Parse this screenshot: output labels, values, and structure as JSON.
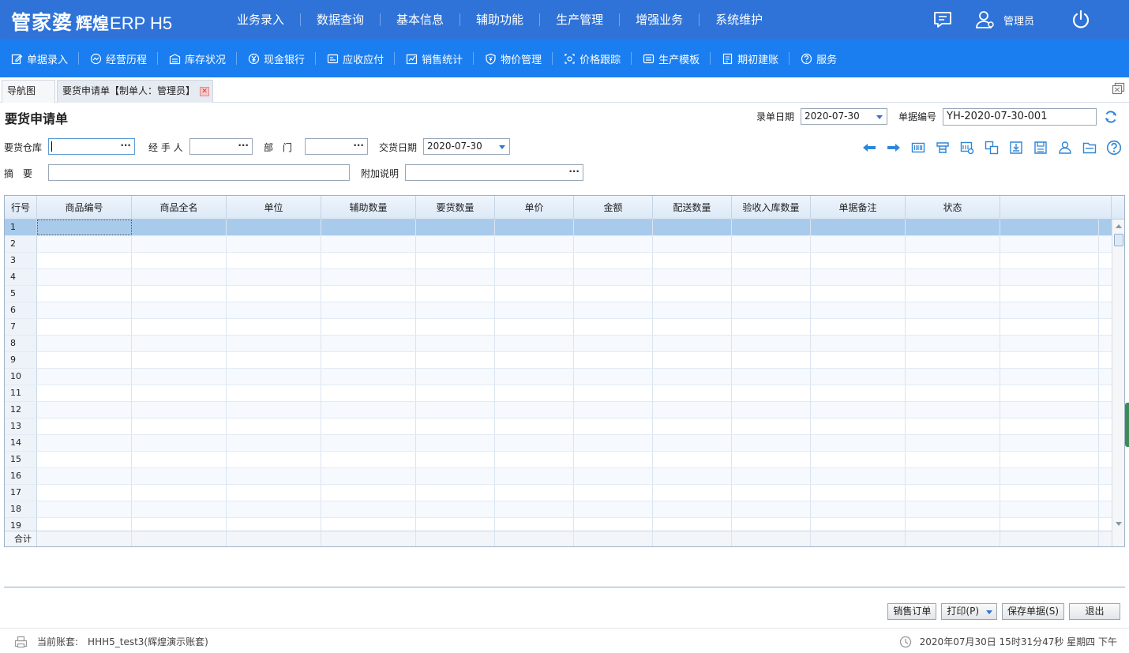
{
  "app": {
    "logo_brand": "管家婆",
    "logo_sub": "辉煌",
    "logo_product": "ERP H5"
  },
  "topnav": [
    "业务录入",
    "数据查询",
    "基本信息",
    "辅助功能",
    "生产管理",
    "增强业务",
    "系统维护"
  ],
  "user": {
    "name": "管理员"
  },
  "toolbar": [
    {
      "label": "单据录入",
      "icon": "document-edit-icon"
    },
    {
      "label": "经营历程",
      "icon": "chart-circle-icon"
    },
    {
      "label": "库存状况",
      "icon": "warehouse-icon"
    },
    {
      "label": "现金银行",
      "icon": "yen-icon"
    },
    {
      "label": "应收应付",
      "icon": "receivable-icon"
    },
    {
      "label": "销售统计",
      "icon": "sales-chart-icon"
    },
    {
      "label": "物价管理",
      "icon": "shield-yen-icon"
    },
    {
      "label": "价格跟踪",
      "icon": "price-track-icon"
    },
    {
      "label": "生产模板",
      "icon": "template-icon"
    },
    {
      "label": "期初建账",
      "icon": "ledger-icon"
    },
    {
      "label": "服务",
      "icon": "help-circle-icon"
    }
  ],
  "tabs": [
    {
      "label": "导航图"
    },
    {
      "label": "要货申请单【制单人：管理员】"
    }
  ],
  "form": {
    "title": "要货申请单",
    "entry_date_label": "录单日期",
    "entry_date": "2020-07-30",
    "doc_no_label": "单据编号",
    "doc_no": "YH-2020-07-30-001",
    "warehouse_label": "要货仓库",
    "warehouse": "",
    "handler_label": "经 手 人",
    "handler": "",
    "dept_label": "部　门",
    "dept": "",
    "delivery_date_label": "交货日期",
    "delivery_date": "2020-07-30",
    "summary_label": "摘　要",
    "summary": "",
    "note_label": "附加说明",
    "note": "",
    "dots": "···"
  },
  "grid": {
    "columns": [
      "行号",
      "商品编号",
      "商品全名",
      "单位",
      "辅助数量",
      "要货数量",
      "单价",
      "金额",
      "配送数量",
      "验收入库数量",
      "单据备注",
      "状态",
      ""
    ],
    "rows": [
      "1",
      "2",
      "3",
      "4",
      "5",
      "6",
      "7",
      "8",
      "9",
      "10",
      "11",
      "12",
      "13",
      "14",
      "15",
      "16",
      "17",
      "18",
      "19"
    ],
    "footer_label": "合计"
  },
  "buttons": {
    "sales_order": "销售订单",
    "print": "打印(P)",
    "save": "保存单据(S)",
    "exit": "退出"
  },
  "status": {
    "account_label": "当前账套:",
    "account": "HHH5_test3(辉煌演示账套)",
    "datetime": "2020年07月30日 15时31分47秒 星期四 下午"
  },
  "colors": {
    "topbar": "#2f73d8",
    "toolbar": "#1a7ef0",
    "selected_row": "#a8cbec",
    "icon_blue": "#2f86d8"
  }
}
